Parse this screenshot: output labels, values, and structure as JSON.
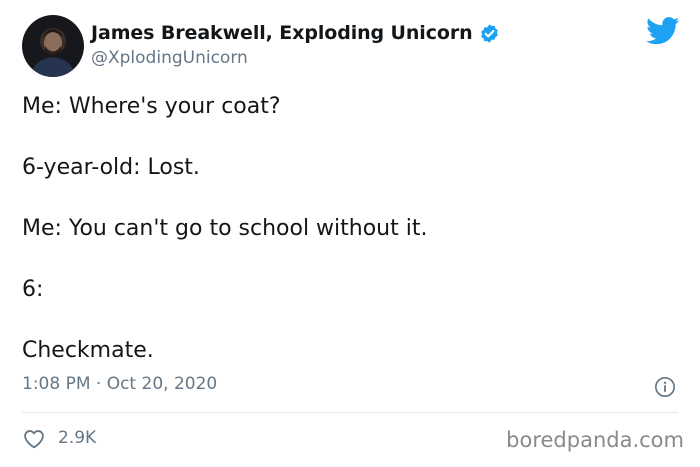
{
  "tweet": {
    "author": {
      "display_name": "James Breakwell, Exploding Unicorn",
      "handle": "@XplodingUnicorn",
      "verified": true
    },
    "lines": [
      "Me: Where's your coat?",
      "6-year-old: Lost.",
      "Me: You can't go to school without it.",
      "6:",
      "Checkmate."
    ],
    "timestamp": "1:08 PM · Oct 20, 2020",
    "likes": "2.9K"
  },
  "watermark": "boredpanda.com",
  "colors": {
    "twitter_blue": "#1da1f2",
    "text": "#14171a",
    "muted": "#657786",
    "divider": "#e1e8ed"
  },
  "icons": [
    "avatar",
    "verified-badge-icon",
    "twitter-bird-icon",
    "info-icon",
    "heart-icon"
  ]
}
